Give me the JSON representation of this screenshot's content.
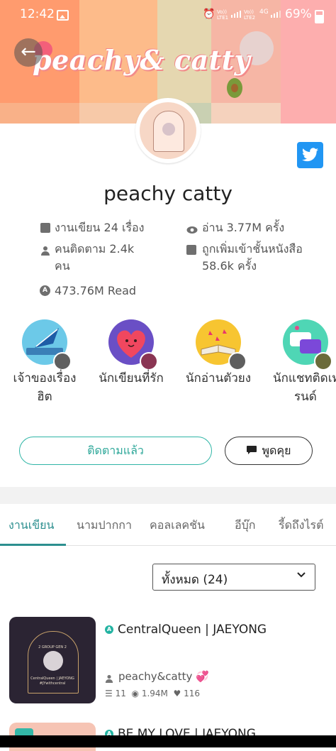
{
  "status_bar": {
    "time": "12:42",
    "sim1_label": "Vo))\nLTE1",
    "sim2_label": "Vo))\nLTE2",
    "network": "4G",
    "battery": "69%"
  },
  "banner": {
    "title": "peachy& catty",
    "colors": [
      "#ff9b6e",
      "#fcc79b",
      "#e5d7b0",
      "#bfc9a2",
      "#f9a7a1",
      "#f5d2bd",
      "#fdaeae"
    ]
  },
  "profile": {
    "username": "peachy catty",
    "stats": {
      "works": "งานเขียน 24 เรื่อง",
      "reads": "อ่าน 3.77M ครั้ง",
      "followers_line1": "คนติดตาม 2.4k",
      "followers_line2": "คน",
      "shelf_line1": "ถูกเพิ่มเข้าชั้นหนังสือ",
      "shelf_line2": "58.6k ครั้ง",
      "total_read": "473.76M Read"
    }
  },
  "badges": [
    {
      "label_line1": "เจ้าของเรื่อง",
      "label_line2": "ฮิต"
    },
    {
      "label_line1": "นักเขียนที่รัก",
      "label_line2": ""
    },
    {
      "label_line1": "นักอ่านตัวยง",
      "label_line2": ""
    },
    {
      "label_line1": "นักแชทติดเท",
      "label_line2": "รนด์"
    }
  ],
  "actions": {
    "follow": "ติดตามแล้ว",
    "chat": "พูดคุย"
  },
  "tabs": [
    "งานเขียน",
    "นามปากกา",
    "คอลเลคชัน",
    "อีบุ๊ก",
    "รี้ดถึงไรต์"
  ],
  "filter": {
    "selected": "ทั้งหมด (24)"
  },
  "stories": [
    {
      "title": "CentralQueen | JAEYONG",
      "author": "peachy&catty 💞",
      "chapters": "11",
      "reads": "1.94M",
      "likes": "116",
      "cover_text": {
        "top": "2 GROUP GEN 2",
        "name": "CentralQueen | JAEYONG",
        "tag": "#JYwithcentral"
      }
    },
    {
      "title": "BE MY LOVE | JAEYONG"
    }
  ]
}
